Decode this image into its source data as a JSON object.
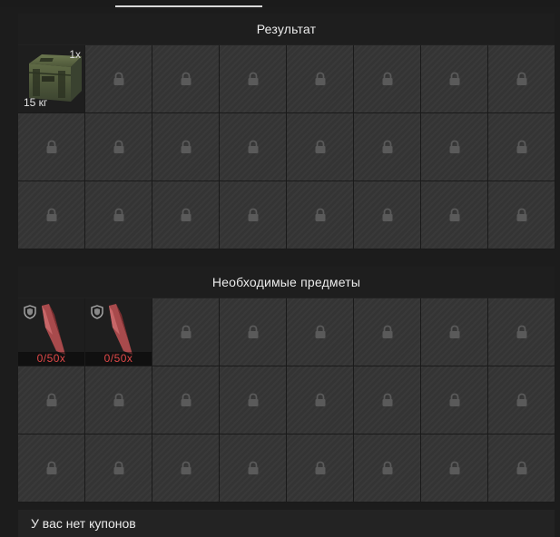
{
  "result": {
    "title": "Результат",
    "item": {
      "name_icon": "military-crate",
      "quantity": "1x",
      "weight": "15 кг"
    }
  },
  "required": {
    "title": "Необходимые предметы",
    "items": [
      {
        "icon": "red-crystal-shard",
        "count": "0/50x"
      },
      {
        "icon": "red-crystal-shard",
        "count": "0/50x"
      }
    ]
  },
  "footer": {
    "text": "У вас нет купонов"
  },
  "colors": {
    "missing_count": "#e04848",
    "slot_locked": "#343434"
  }
}
